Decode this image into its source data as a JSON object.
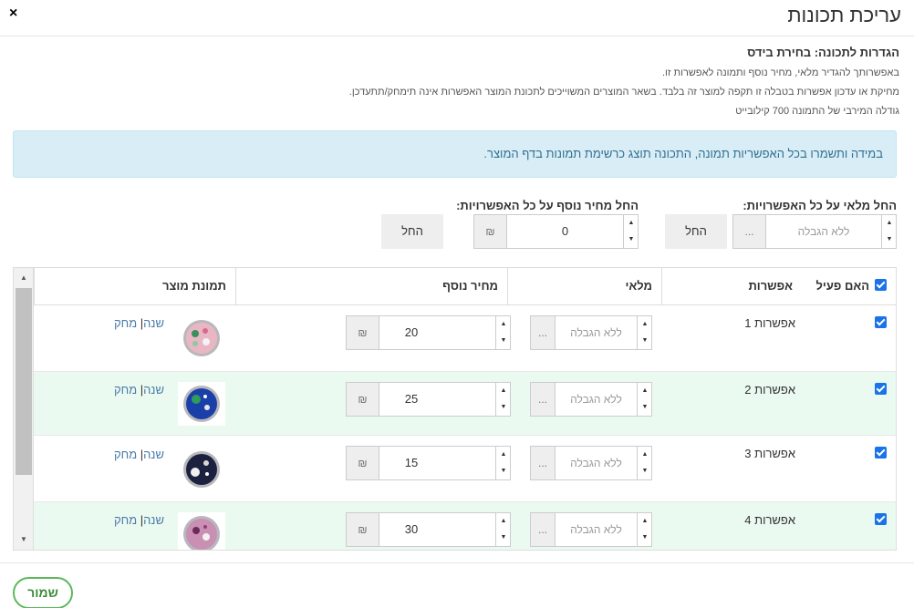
{
  "modal": {
    "title": "עריכת תכונות",
    "close_icon": "×"
  },
  "settings": {
    "title": "הגדרות לתכונה: בחירת בידס",
    "lines": [
      "באפשרותך להגדיר מלאי, מחיר נוסף ותמונה לאפשרות זו.",
      "מחיקת או עדכון אפשרות בטבלה זו תקפה למוצר זה בלבד. בשאר המוצרים המשוייכים לתכונת המוצר האפשרות אינה תימחק/תתעדכן.",
      "גודלה המירבי של התמונה 700 קילובייט"
    ]
  },
  "alert": {
    "text": "במידה ותשמרו בכל האפשריות תמונה, התכונה תוצג כרשימת תמונות בדף המוצר."
  },
  "bulk": {
    "stock_label": "החל מלאי על כל האפשרויות:",
    "stock_placeholder": "ללא הגבלה",
    "stock_addon": "...",
    "stock_apply": "החל",
    "price_label": "החל מחיר נוסף על כל האפשרויות:",
    "price_value": "0",
    "price_currency": "₪",
    "price_apply": "החל"
  },
  "table": {
    "headers": {
      "active": "האם פעיל",
      "option": "אפשרות",
      "stock": "מלאי",
      "extra_price": "מחיר נוסף",
      "image": "תמונת מוצר"
    },
    "rows": [
      {
        "option": "אפשרות 1",
        "stock_placeholder": "ללא הגבלה",
        "stock_addon": "...",
        "price": "20",
        "currency": "₪",
        "change": "שנה",
        "delete": "מחק",
        "sep": "|",
        "bead_color": "#e9b7c3"
      },
      {
        "option": "אפשרות 2",
        "stock_placeholder": "ללא הגבלה",
        "stock_addon": "...",
        "price": "25",
        "currency": "₪",
        "change": "שנה",
        "delete": "מחק",
        "sep": "|",
        "bead_color": "#1b3fa8"
      },
      {
        "option": "אפשרות 3",
        "stock_placeholder": "ללא הגבלה",
        "stock_addon": "...",
        "price": "15",
        "currency": "₪",
        "change": "שנה",
        "delete": "מחק",
        "sep": "|",
        "bead_color": "#1d2140"
      },
      {
        "option": "אפשרות 4",
        "stock_placeholder": "ללא הגבלה",
        "stock_addon": "...",
        "price": "30",
        "currency": "₪",
        "change": "שנה",
        "delete": "מחק",
        "sep": "|",
        "bead_color": "#c990b4"
      }
    ]
  },
  "footer": {
    "save_label": "שמור"
  },
  "colors": {
    "accent": "#5cb85c",
    "link": "#4a7ba7",
    "alert_bg": "#d9edf7",
    "row_alt": "#ebfaf1",
    "checkbox": "#1a73e8"
  }
}
